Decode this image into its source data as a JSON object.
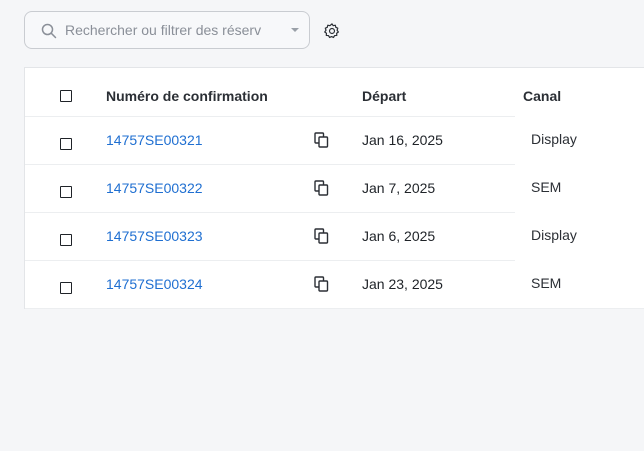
{
  "search": {
    "placeholder": "Rechercher ou filtrer des réserv",
    "value": ""
  },
  "table": {
    "headers": {
      "confirmation": "Numéro de confirmation",
      "departure": "Départ",
      "channel": "Canal"
    },
    "rows": [
      {
        "confirmation": "14757SE00321",
        "departure": "Jan 16, 2025",
        "channel": "Display"
      },
      {
        "confirmation": "14757SE00322",
        "departure": "Jan 7, 2025",
        "channel": "SEM"
      },
      {
        "confirmation": "14757SE00323",
        "departure": "Jan 6, 2025",
        "channel": "Display"
      },
      {
        "confirmation": "14757SE00324",
        "departure": "Jan 23, 2025",
        "channel": "SEM"
      }
    ]
  },
  "colors": {
    "link": "#1f6fd1",
    "background": "#f5f6f8",
    "border": "#c9ccd1"
  },
  "icons": [
    "search-icon",
    "chevron-down-icon",
    "gear-icon",
    "copy-icon"
  ]
}
